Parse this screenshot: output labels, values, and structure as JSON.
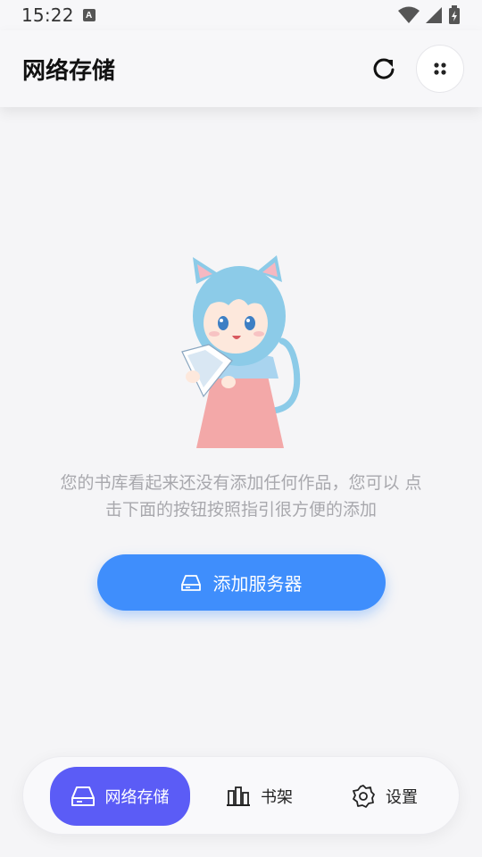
{
  "status_bar": {
    "time": "15:22",
    "notif_letter": "A"
  },
  "app_bar": {
    "title": "网络存储"
  },
  "empty_state": {
    "message": "您的书库看起来还没有添加任何作品，您可以 点击下面的按钮按照指引很方便的添加",
    "button_label": "添加服务器"
  },
  "bottom_nav": {
    "items": [
      {
        "label": "网络存储",
        "icon": "server-drive-icon",
        "active": true
      },
      {
        "label": "书架",
        "icon": "bookshelf-icon",
        "active": false
      },
      {
        "label": "设置",
        "icon": "gear-icon",
        "active": false
      }
    ]
  },
  "colors": {
    "accent_button": "#3f8efc",
    "nav_active": "#5b5cf6",
    "background": "#f5f5f7",
    "muted_text": "#a8a8ad"
  }
}
